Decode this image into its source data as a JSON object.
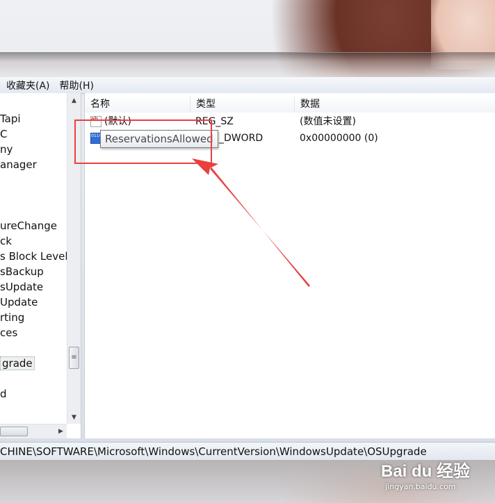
{
  "menu": {
    "favorites": "收藏夹(A)",
    "help": "帮助(H)"
  },
  "tree": {
    "nodes": [
      {
        "label": "Tapi"
      },
      {
        "label": "C"
      },
      {
        "label": "ny"
      },
      {
        "label": "anager"
      },
      {
        "label": ""
      },
      {
        "label": ""
      },
      {
        "label": ""
      },
      {
        "label": "ureChange"
      },
      {
        "label": "ck"
      },
      {
        "label": "s Block Level B"
      },
      {
        "label": "sBackup"
      },
      {
        "label": "sUpdate"
      },
      {
        "label": "Update"
      },
      {
        "label": "rting"
      },
      {
        "label": "ces"
      },
      {
        "label": ""
      },
      {
        "label": "grade",
        "selected": true
      },
      {
        "label": ""
      },
      {
        "label": "d"
      },
      {
        "label": ""
      }
    ]
  },
  "values": {
    "columns": {
      "name": "名称",
      "type": "类型",
      "data": "数据"
    },
    "rows": [
      {
        "icon": "string-value-icon",
        "name": "(默认)",
        "type": "REG_SZ",
        "data": "(数值未设置)"
      },
      {
        "icon": "dword-value-icon",
        "name": "ReservationsAllowed",
        "type": "REG_DWORD",
        "type_visible": "_DWORD",
        "data": "0x00000000 (0)"
      }
    ],
    "tooltip": "ReservationsAllowed"
  },
  "statusbar": {
    "path": "CHINE\\SOFTWARE\\Microsoft\\Windows\\CurrentVersion\\WindowsUpdate\\OSUpgrade"
  },
  "watermark": {
    "logo": "Bai du 经验",
    "url": "jingyan.baidu.com"
  },
  "colors": {
    "annotation": "#e94040",
    "menu_bg": "#e3e9f2",
    "selection": "#f0f0f0"
  }
}
